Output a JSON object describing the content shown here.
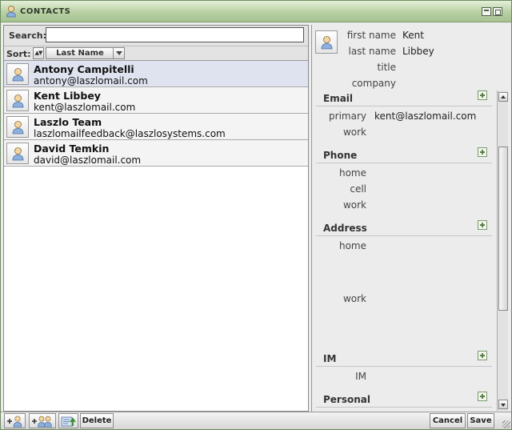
{
  "window": {
    "title": "CONTACTS"
  },
  "search": {
    "label": "Search:",
    "value": "",
    "placeholder": ""
  },
  "sort": {
    "label": "Sort:",
    "direction_glyph": "▲▼",
    "field": "Last Name"
  },
  "contacts": [
    {
      "name": "Antony Campitelli",
      "email": "antony@laszlomail.com",
      "selected": true
    },
    {
      "name": "Kent Libbey",
      "email": "kent@laszlomail.com",
      "selected": false
    },
    {
      "name": "Laszlo Team",
      "email": "laszlomailfeedback@laszlosystems.com",
      "selected": false
    },
    {
      "name": "David Temkin",
      "email": "david@laszlomail.com",
      "selected": false
    }
  ],
  "detail": {
    "first_name_label": "first name",
    "first_name": "Kent",
    "last_name_label": "last name",
    "last_name": "Libbey",
    "title_label": "title",
    "title": "",
    "company_label": "company",
    "company": "",
    "email": {
      "heading": "Email",
      "primary_label": "primary",
      "primary": "kent@laszlomail.com",
      "work_label": "work",
      "work": ""
    },
    "phone": {
      "heading": "Phone",
      "home_label": "home",
      "cell_label": "cell",
      "work_label": "work"
    },
    "address": {
      "heading": "Address",
      "home_label": "home",
      "work_label": "work"
    },
    "im": {
      "heading": "IM",
      "im_label": "IM"
    },
    "personal": {
      "heading": "Personal"
    }
  },
  "toolbar": {
    "delete_label": "Delete",
    "cancel_label": "Cancel",
    "save_label": "Save"
  },
  "colors": {
    "titlebar": "#b9d0a4",
    "selected_row": "#dfe3ef",
    "plus_accent": "#5c7d4c"
  },
  "icons": [
    "user-icon",
    "add-contact-icon",
    "add-group-icon",
    "export-icon",
    "plus-icon",
    "minimize-icon",
    "maximize-icon"
  ]
}
